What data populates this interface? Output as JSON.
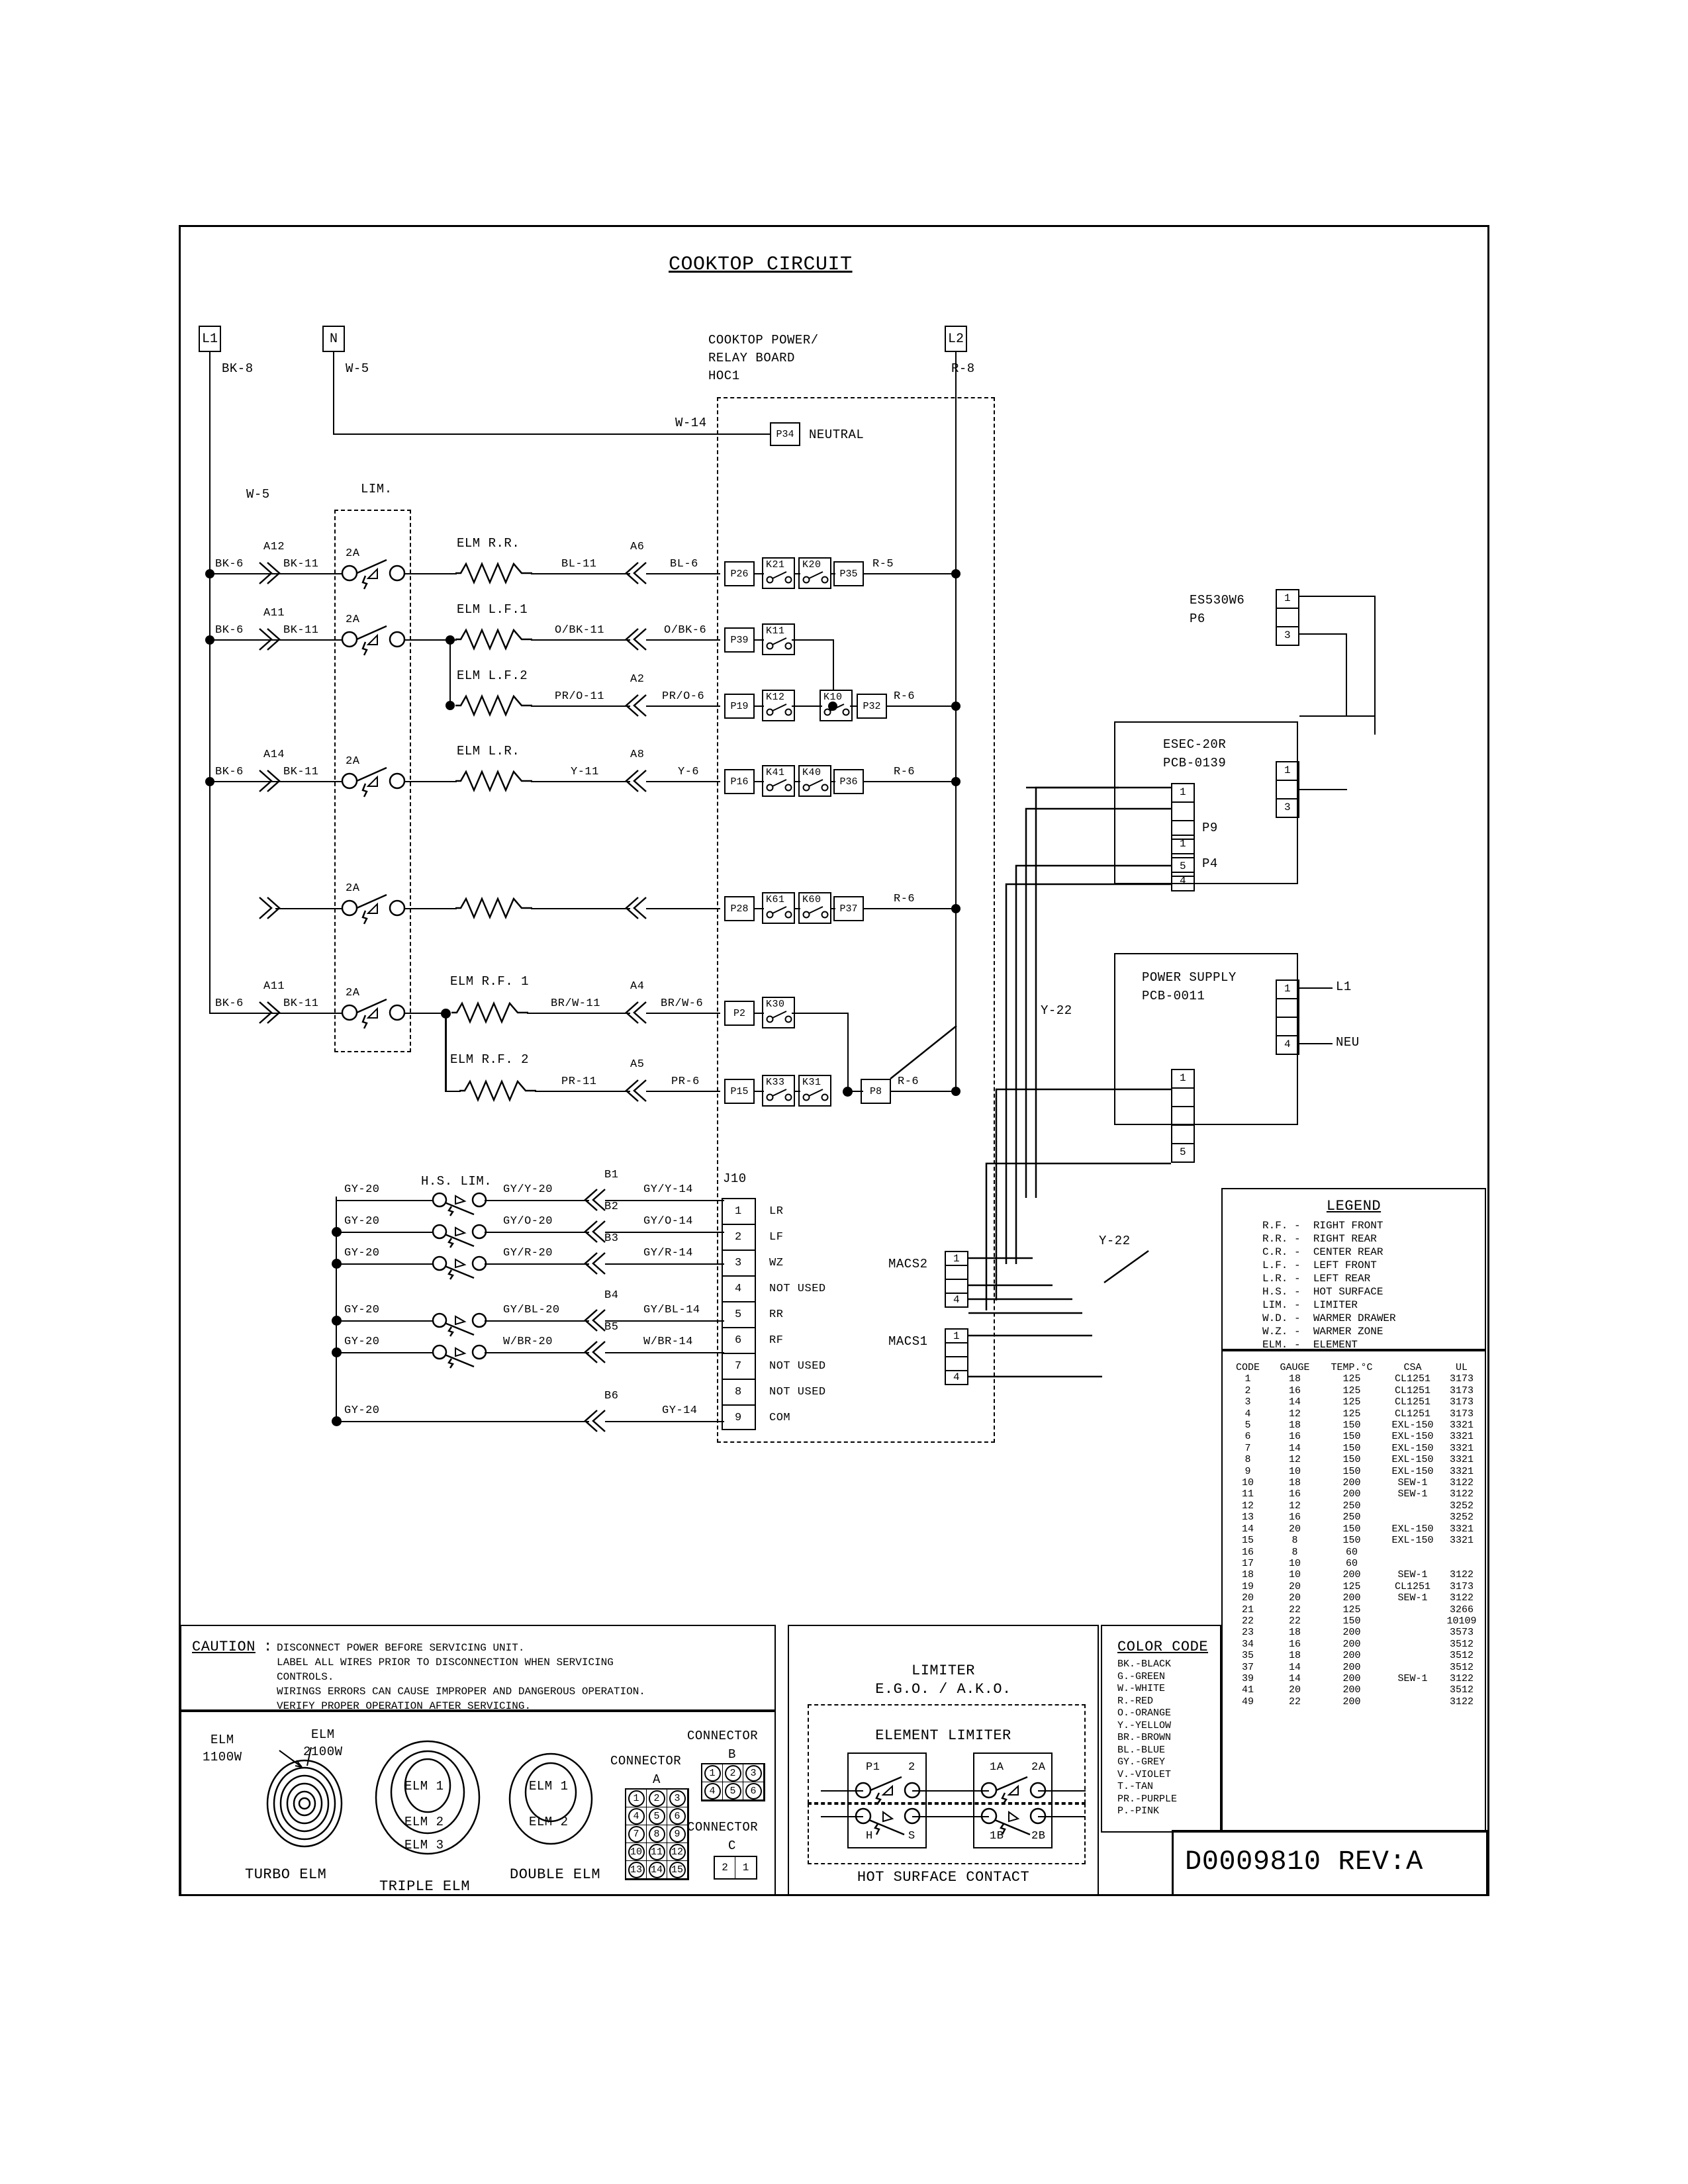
{
  "sheet": {
    "title": "COOKTOP CIRCUIT",
    "drawing_number": "D0009810 REV:A"
  },
  "supply": {
    "l1_label": "L1",
    "l1_wire": "BK-8",
    "n_label": "N",
    "n_wire": "W-5",
    "l2_label": "L2",
    "l2_wire": "R-8",
    "n_branch_wire": "W-5"
  },
  "relay_board": {
    "name_line1": "COOKTOP POWER/",
    "name_line2": "RELAY BOARD",
    "name_line3": "HOC1",
    "neutral_pin": "P34",
    "neutral_label": "NEUTRAL",
    "neutral_wire": "W-14"
  },
  "limiter_block": {
    "label": "LIM."
  },
  "rows": [
    {
      "left_wire": "BK-6",
      "splice": "A12",
      "mid_wire": "BK-11",
      "fuse": "2A",
      "element": "ELM R.R.",
      "out_wire": "BL-11",
      "conn": "A6",
      "in_wire": "BL-6",
      "pin_in": "P26",
      "relay1": "K21",
      "relay2": "K20",
      "pin_out": "P35",
      "right_wire": "R-5"
    },
    {
      "left_wire": "BK-6",
      "splice": "A11",
      "mid_wire": "BK-11",
      "fuse": "2A",
      "element": "ELM L.F.1",
      "out_wire": "O/BK-11",
      "conn": "",
      "in_wire": "O/BK-6",
      "pin_in": "P39",
      "relay1": "K11",
      "relay2": "",
      "pin_out": "",
      "right_wire": ""
    },
    {
      "left_wire": "",
      "splice": "",
      "mid_wire": "",
      "fuse": "",
      "element": "ELM L.F.2",
      "out_wire": "PR/O-11",
      "conn": "A2",
      "in_wire": "PR/O-6",
      "pin_in": "P19",
      "relay1": "K12",
      "relay2": "K10",
      "pin_out": "P32",
      "right_wire": "R-6"
    },
    {
      "left_wire": "BK-6",
      "splice": "A14",
      "mid_wire": "BK-11",
      "fuse": "2A",
      "element": "ELM L.R.",
      "out_wire": "Y-11",
      "conn": "A8",
      "in_wire": "Y-6",
      "pin_in": "P16",
      "relay1": "K41",
      "relay2": "K40",
      "pin_out": "P36",
      "right_wire": "R-6"
    },
    {
      "left_wire": "",
      "splice": "",
      "mid_wire": "",
      "fuse": "2A",
      "element": "",
      "out_wire": "",
      "conn": "",
      "in_wire": "",
      "pin_in": "P28",
      "relay1": "K61",
      "relay2": "K60",
      "pin_out": "P37",
      "right_wire": "R-6"
    },
    {
      "left_wire": "BK-6",
      "splice": "A11",
      "mid_wire": "BK-11",
      "fuse": "2A",
      "element": "ELM R.F. 1",
      "out_wire": "BR/W-11",
      "conn": "A4",
      "in_wire": "BR/W-6",
      "pin_in": "P2",
      "relay1": "K30",
      "relay2": "",
      "pin_out": "",
      "right_wire": ""
    },
    {
      "left_wire": "",
      "splice": "",
      "mid_wire": "",
      "fuse": "",
      "element": "ELM R.F. 2",
      "out_wire": "PR-11",
      "conn": "A5",
      "in_wire": "PR-6",
      "pin_in": "P15",
      "relay1": "K33",
      "relay2": "K31",
      "pin_out": "P8",
      "right_wire": "R-6"
    }
  ],
  "hs_lim": {
    "title": "H.S. LIM.",
    "rows": [
      {
        "left_wire": "GY-20",
        "out_wire": "GY/Y-20",
        "conn": "B1",
        "in_wire": "GY/Y-14"
      },
      {
        "left_wire": "GY-20",
        "out_wire": "GY/O-20",
        "conn": "B2",
        "in_wire": "GY/O-14"
      },
      {
        "left_wire": "GY-20",
        "out_wire": "GY/R-20",
        "conn": "B3",
        "in_wire": "GY/R-14"
      },
      {
        "left_wire": "GY-20",
        "out_wire": "GY/BL-20",
        "conn": "B4",
        "in_wire": "GY/BL-14"
      },
      {
        "left_wire": "GY-20",
        "out_wire": "W/BR-20",
        "conn": "B5",
        "in_wire": "W/BR-14"
      },
      {
        "left_wire": "GY-20",
        "out_wire": "",
        "conn": "B6",
        "in_wire": "GY-14"
      }
    ]
  },
  "j10": {
    "label": "J10",
    "pins": [
      {
        "num": "1",
        "name": "LR"
      },
      {
        "num": "2",
        "name": "LF"
      },
      {
        "num": "3",
        "name": "WZ"
      },
      {
        "num": "4",
        "name": "NOT USED"
      },
      {
        "num": "5",
        "name": "RR"
      },
      {
        "num": "6",
        "name": "RF"
      },
      {
        "num": "7",
        "name": "NOT USED"
      },
      {
        "num": "8",
        "name": "NOT USED"
      },
      {
        "num": "9",
        "name": "COM"
      }
    ]
  },
  "macs": {
    "macs2_label": "MACS2",
    "macs1_label": "MACS1",
    "pin_top": "1",
    "pin_bottom": "4",
    "harness_wire_upper": "Y-22",
    "harness_wire_lower": "Y-22"
  },
  "boards": {
    "es530w6": {
      "name": "ES530W6",
      "conn": "P6",
      "pin_top": "1",
      "pin_bottom": "3"
    },
    "esec20r": {
      "name": "ESEC-20R",
      "pcb": "PCB-0139",
      "right_conn_top": "1",
      "right_conn_bottom": "3",
      "p9_label": "P9",
      "p9_top": "1",
      "p9_bottom": "5",
      "p4_label": "P4",
      "p4_top": "1",
      "p4_bottom": "4"
    },
    "power_supply": {
      "name": "POWER SUPPLY",
      "pcb": "PCB-0011",
      "pin_top": "1",
      "pin_bottom": "4",
      "l1_label": "L1",
      "neu_label": "NEU",
      "lower_top": "1",
      "lower_bottom": "5"
    }
  },
  "legend": {
    "title": "LEGEND",
    "entries": [
      "R.F. -  RIGHT FRONT",
      "R.R. -  RIGHT REAR",
      "C.R. -  CENTER REAR",
      "L.F. -  LEFT FRONT",
      "L.R. -  LEFT REAR",
      "H.S. -  HOT SURFACE",
      "LIM. -  LIMITER",
      "W.D. -  WARMER DRAWER",
      "W.Z. -  WARMER ZONE",
      "ELM. -  ELEMENT"
    ]
  },
  "gauge_table": {
    "headers": [
      "CODE",
      "GAUGE",
      "TEMP.°C",
      "CSA",
      "UL"
    ],
    "rows": [
      [
        "1",
        "18",
        "125",
        "CL1251",
        "3173"
      ],
      [
        "2",
        "16",
        "125",
        "CL1251",
        "3173"
      ],
      [
        "3",
        "14",
        "125",
        "CL1251",
        "3173"
      ],
      [
        "4",
        "12",
        "125",
        "CL1251",
        "3173"
      ],
      [
        "5",
        "18",
        "150",
        "EXL-150",
        "3321"
      ],
      [
        "6",
        "16",
        "150",
        "EXL-150",
        "3321"
      ],
      [
        "7",
        "14",
        "150",
        "EXL-150",
        "3321"
      ],
      [
        "8",
        "12",
        "150",
        "EXL-150",
        "3321"
      ],
      [
        "9",
        "10",
        "150",
        "EXL-150",
        "3321"
      ],
      [
        "10",
        "18",
        "200",
        "SEW-1",
        "3122"
      ],
      [
        "11",
        "16",
        "200",
        "SEW-1",
        "3122"
      ],
      [
        "12",
        "12",
        "250",
        "",
        "3252"
      ],
      [
        "13",
        "16",
        "250",
        "",
        "3252"
      ],
      [
        "14",
        "20",
        "150",
        "EXL-150",
        "3321"
      ],
      [
        "15",
        "8",
        "150",
        "EXL-150",
        "3321"
      ],
      [
        "16",
        "8",
        "60",
        "",
        ""
      ],
      [
        "17",
        "10",
        "60",
        "",
        ""
      ],
      [
        "18",
        "10",
        "200",
        "SEW-1",
        "3122"
      ],
      [
        "19",
        "20",
        "125",
        "CL1251",
        "3173"
      ],
      [
        "20",
        "20",
        "200",
        "SEW-1",
        "3122"
      ],
      [
        "21",
        "22",
        "125",
        "",
        "3266"
      ],
      [
        "22",
        "22",
        "150",
        "",
        "10109"
      ],
      [
        "23",
        "18",
        "200",
        "",
        "3573"
      ],
      [
        "34",
        "16",
        "200",
        "",
        "3512"
      ],
      [
        "35",
        "18",
        "200",
        "",
        "3512"
      ],
      [
        "37",
        "14",
        "200",
        "",
        "3512"
      ],
      [
        "39",
        "14",
        "200",
        "SEW-1",
        "3122"
      ],
      [
        "41",
        "20",
        "200",
        "",
        "3512"
      ],
      [
        "49",
        "22",
        "200",
        "",
        "3122"
      ]
    ]
  },
  "color_code": {
    "title": "COLOR CODE",
    "entries": [
      "BK.-BLACK",
      "G.-GREEN",
      "W.-WHITE",
      "R.-RED",
      "O.-ORANGE",
      "Y.-YELLOW",
      "BR.-BROWN",
      "BL.-BLUE",
      "GY.-GREY",
      "V.-VIOLET",
      "T.-TAN",
      "PR.-PURPLE",
      "P.-PINK"
    ]
  },
  "caution": {
    "title": "CAUTION",
    "colon": ":",
    "lines": [
      "DISCONNECT POWER BEFORE SERVICING UNIT.",
      "LABEL ALL WIRES PRIOR TO DISCONNECTION WHEN SERVICING",
      "CONTROLS.",
      "WIRINGS ERRORS CAN CAUSE IMPROPER AND DANGEROUS OPERATION.",
      "VERIFY PROPER OPERATION AFTER SERVICING."
    ]
  },
  "elements": {
    "turbo": {
      "caption": "TURBO ELM",
      "lead1_l1": "ELM",
      "lead1_l2": "1100W",
      "lead2_l1": "ELM",
      "lead2_l2": "2100W"
    },
    "triple": {
      "caption": "TRIPLE ELM",
      "r1": "ELM 1",
      "r2": "ELM 2",
      "r3": "ELM 3"
    },
    "double": {
      "caption": "DOUBLE ELM",
      "r1": "ELM 1",
      "r2": "ELM 2"
    }
  },
  "connectors": {
    "a": {
      "title_l1": "CONNECTOR",
      "title_l2": "A",
      "cells": [
        "1",
        "2",
        "3",
        "4",
        "5",
        "6",
        "7",
        "8",
        "9",
        "10",
        "11",
        "12",
        "13",
        "14",
        "15"
      ]
    },
    "b": {
      "title_l1": "CONNECTOR",
      "title_l2": "B",
      "cells": [
        "1",
        "2",
        "3",
        "4",
        "5",
        "6"
      ]
    },
    "c": {
      "title_l1": "CONNECTOR",
      "title_l2": "C",
      "cells": [
        "2",
        "1"
      ]
    }
  },
  "limiter_panel": {
    "title_l1": "LIMITER",
    "title_l2": "E.G.O. / A.K.O.",
    "elm_title": "ELEMENT LIMITER",
    "hs_title": "HOT SURFACE CONTACT",
    "left_box": {
      "tl": "P1",
      "tr": "2",
      "bl": "H",
      "br": "S"
    },
    "right_box": {
      "tl": "1A",
      "tr": "2A",
      "bl": "1B",
      "br": "2B"
    }
  }
}
